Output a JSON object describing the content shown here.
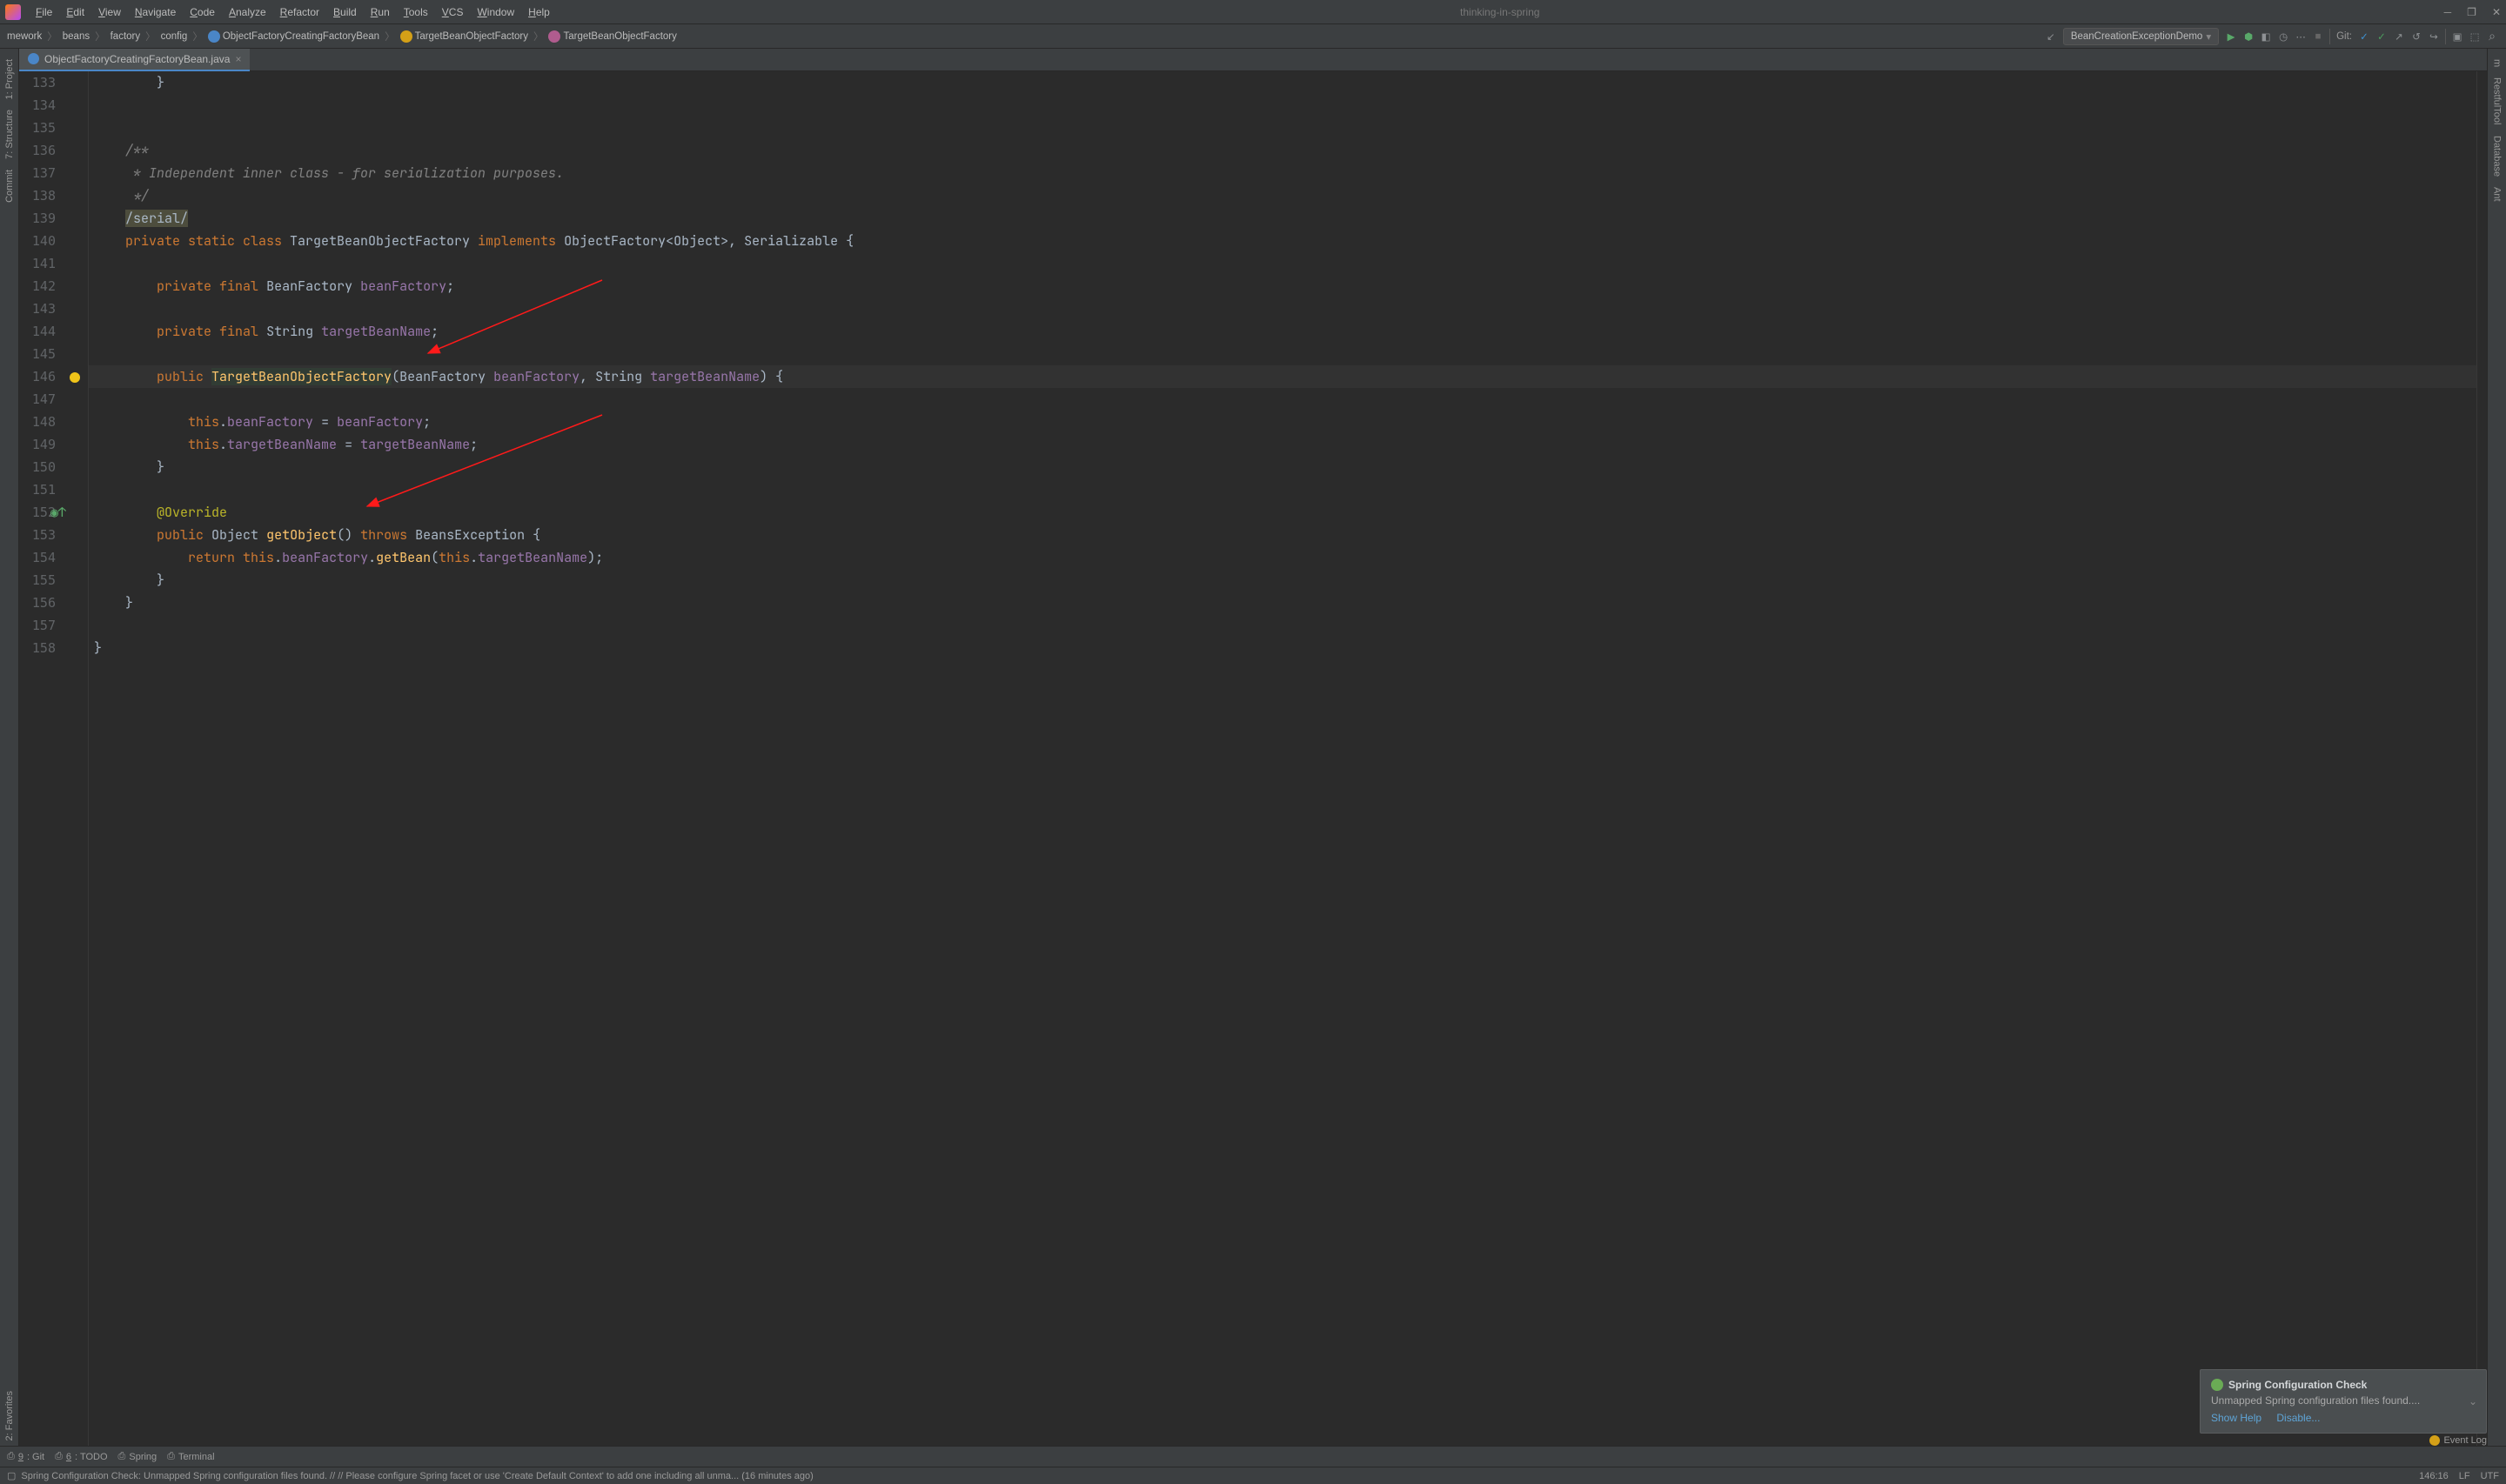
{
  "title": "thinking-in-spring",
  "menuBar": [
    "File",
    "Edit",
    "View",
    "Navigate",
    "Code",
    "Analyze",
    "Refactor",
    "Build",
    "Run",
    "Tools",
    "VCS",
    "Window",
    "Help"
  ],
  "breadcrumb": [
    {
      "label": "mework"
    },
    {
      "label": "beans"
    },
    {
      "label": "factory"
    },
    {
      "label": "config"
    },
    {
      "label": "ObjectFactoryCreatingFactoryBean",
      "icon": "c"
    },
    {
      "label": "TargetBeanObjectFactory",
      "icon": "t"
    },
    {
      "label": "TargetBeanObjectFactory",
      "icon": "m"
    }
  ],
  "runConfig": {
    "name": "BeanCreationExceptionDemo"
  },
  "gitLabel": "Git:",
  "tabs": [
    {
      "name": "ObjectFactoryCreatingFactoryBean.java"
    }
  ],
  "lineStart": 133,
  "lineEnd": 158,
  "code": [
    "        }",
    "",
    "",
    "    /**",
    "     * Independent inner class - for serialization purposes.",
    "     */",
    "    /serial/",
    "    private static class TargetBeanObjectFactory implements ObjectFactory<Object>, Serializable {",
    "",
    "        private final BeanFactory beanFactory;",
    "",
    "        private final String targetBeanName;",
    "",
    "        public TargetBeanObjectFactory(BeanFactory beanFactory, String targetBeanName) {",
    "            this.beanFactory = beanFactory;",
    "            this.targetBeanName = targetBeanName;",
    "        }",
    "",
    "        @Override",
    "        public Object getObject() throws BeansException {",
    "            return this.beanFactory.getBean(this.targetBeanName);",
    "        }",
    "    }",
    "",
    "}",
    ""
  ],
  "leftTools": [
    {
      "label": "1: Project"
    },
    {
      "label": "7: Structure"
    },
    {
      "label": "Commit"
    },
    {
      "label": "2: Favorites"
    }
  ],
  "rightTools": [
    {
      "label": "m"
    },
    {
      "label": "RestfulTool"
    },
    {
      "label": "Database"
    },
    {
      "label": "Ant"
    }
  ],
  "bottomTabs": [
    {
      "label": "9: Git",
      "icon": "git"
    },
    {
      "label": "6: TODO",
      "icon": "todo"
    },
    {
      "label": "Spring",
      "icon": "spring"
    },
    {
      "label": "Terminal",
      "icon": "terminal"
    }
  ],
  "notification": {
    "title": "Spring Configuration Check",
    "body": "Unmapped Spring configuration files found....",
    "act1": "Show Help",
    "act2": "Disable..."
  },
  "statusBar": {
    "msg": "Spring Configuration Check: Unmapped Spring configuration files found. // // Please configure Spring facet or use 'Create Default Context' to add one including all unma... (16 minutes ago)",
    "pos": "146:16",
    "le": "LF",
    "enc": "UTF"
  },
  "eventLog": "Event Log"
}
